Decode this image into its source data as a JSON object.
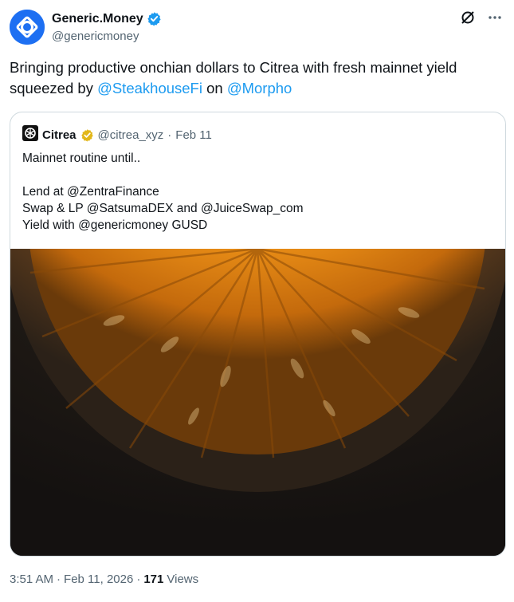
{
  "author": {
    "display_name": "Generic.Money",
    "handle": "@genericmoney",
    "verified": true,
    "avatar_color": "#1d6ff2"
  },
  "tweet": {
    "text_part1": "Bringing productive onchian dollars to Citrea with fresh mainnet yield squeezed by ",
    "mention1": "@SteakhouseFi",
    "text_part2": " on ",
    "mention2": "@Morpho"
  },
  "quoted": {
    "display_name": "Citrea",
    "handle": "@citrea_xyz",
    "separator": "·",
    "date": "Feb 11",
    "verified_gold": true,
    "text": "Mainnet routine until..\n\nLend at @ZentraFinance\nSwap & LP @SatsumaDEX and @JuiceSwap_com\nYield with @genericmoney GUSD",
    "media_description_icon": "orange-slice-image"
  },
  "footer": {
    "time": "3:51 AM",
    "separator1": "·",
    "date": "Feb 11, 2026",
    "separator2": "·",
    "views_count": "171",
    "views_label": "Views"
  },
  "icons": {
    "grok": "grok-icon",
    "more": "more-options-icon",
    "verified": "verified-badge-icon"
  },
  "colors": {
    "link": "#1d9bf0",
    "verified_blue": "#1d9bf0",
    "verified_gold": "#e2b719",
    "secondary_text": "#536471"
  }
}
